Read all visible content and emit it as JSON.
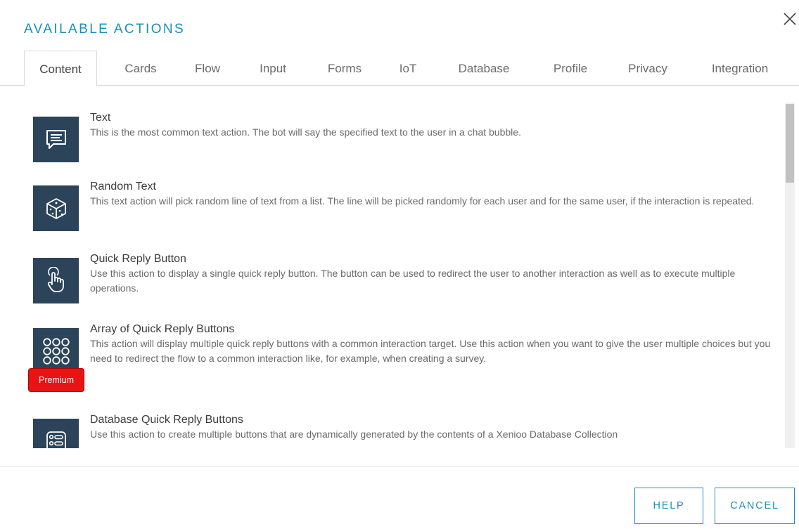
{
  "header": {
    "title": "AVAILABLE ACTIONS"
  },
  "tabs": [
    {
      "label": "Content",
      "active": true
    },
    {
      "label": "Cards"
    },
    {
      "label": "Flow"
    },
    {
      "label": "Input"
    },
    {
      "label": "Forms"
    },
    {
      "label": "IoT"
    },
    {
      "label": "Database"
    },
    {
      "label": "Profile"
    },
    {
      "label": "Privacy"
    },
    {
      "label": "Integration"
    }
  ],
  "actions": [
    {
      "icon": "chat-bubble-text-icon",
      "title": "Text",
      "description": "This is the most common text action. The bot will say the specified text to the user in a chat bubble."
    },
    {
      "icon": "dice-icon",
      "title": "Random Text",
      "description": "This text action will pick random line of text from a list. The line will be picked randomly for each user and for the same user, if the interaction is repeated."
    },
    {
      "icon": "tap-hand-icon",
      "title": "Quick Reply Button",
      "description": "Use this action to display a single quick reply button. The button can be used to redirect the user to another interaction as well as to execute multiple operations."
    },
    {
      "icon": "dot-grid-icon",
      "title": "Array of Quick Reply Buttons",
      "description": "This action will display multiple quick reply buttons with a common interaction target. Use this action when you want to give the user multiple choices but you need to redirect the flow to a common interaction like, for example, when creating a survey.",
      "badge": "Premium"
    },
    {
      "icon": "database-buttons-icon",
      "title": "Database Quick Reply Buttons",
      "description": "Use this action to create multiple buttons that are dynamically generated by the contents of a Xenioo Database Collection"
    }
  ],
  "footer": {
    "help_label": "HELP",
    "cancel_label": "CANCEL"
  },
  "colors": {
    "accent": "#1a8fb9",
    "icon_bg": "#2b4459",
    "premium": "#e81414"
  }
}
